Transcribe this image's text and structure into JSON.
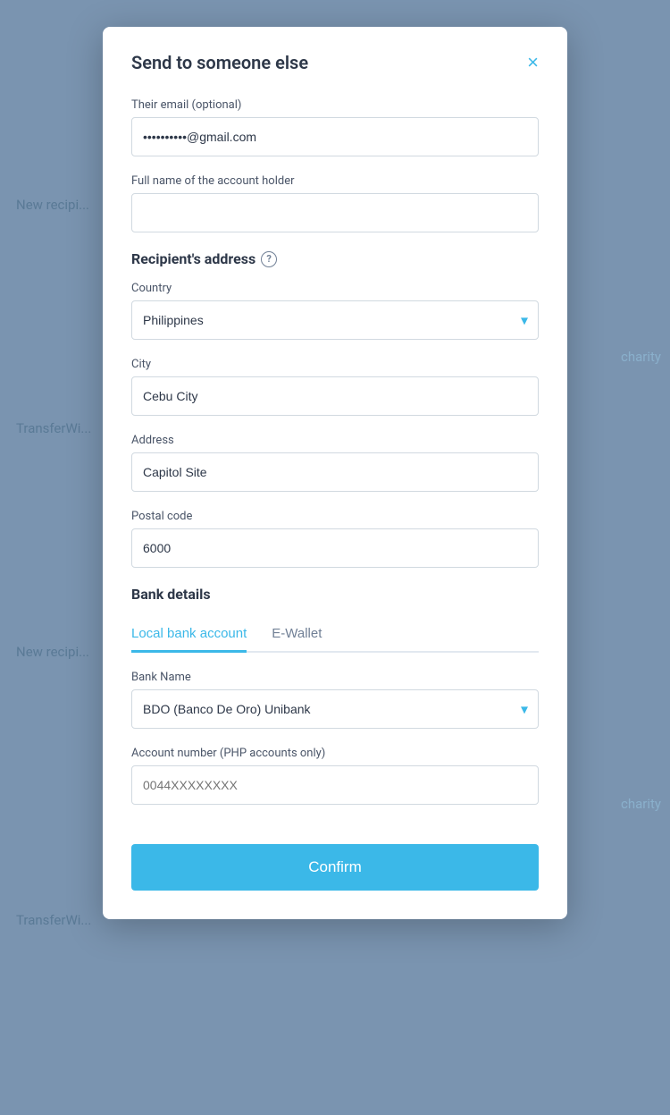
{
  "modal": {
    "title": "Send to someone else",
    "close_label": "×"
  },
  "form": {
    "email_label": "Their email (optional)",
    "email_value": "••••••••••@gmail.com",
    "email_placeholder": "",
    "fullname_label": "Full name of the account holder",
    "fullname_value": "",
    "address_section_label": "Recipient's address",
    "country_label": "Country",
    "country_value": "Philippines",
    "city_label": "City",
    "city_value": "Cebu City",
    "address_label": "Address",
    "address_value": "Capitol Site",
    "postal_label": "Postal code",
    "postal_value": "6000",
    "bank_section_label": "Bank details",
    "tab_local": "Local bank account",
    "tab_ewallet": "E-Wallet",
    "bank_name_label": "Bank Name",
    "bank_name_value": "BDO (Banco De Oro) Unibank",
    "account_number_label": "Account number (PHP accounts only)",
    "account_number_placeholder": "0044XXXXXXXX",
    "confirm_label": "Confirm"
  },
  "backdrop": {
    "text1": "New recipi...",
    "text2": "charity",
    "text3": "TransferWi...",
    "text4": "New recipi...",
    "text5": "charity",
    "text6": "TransferWi..."
  }
}
